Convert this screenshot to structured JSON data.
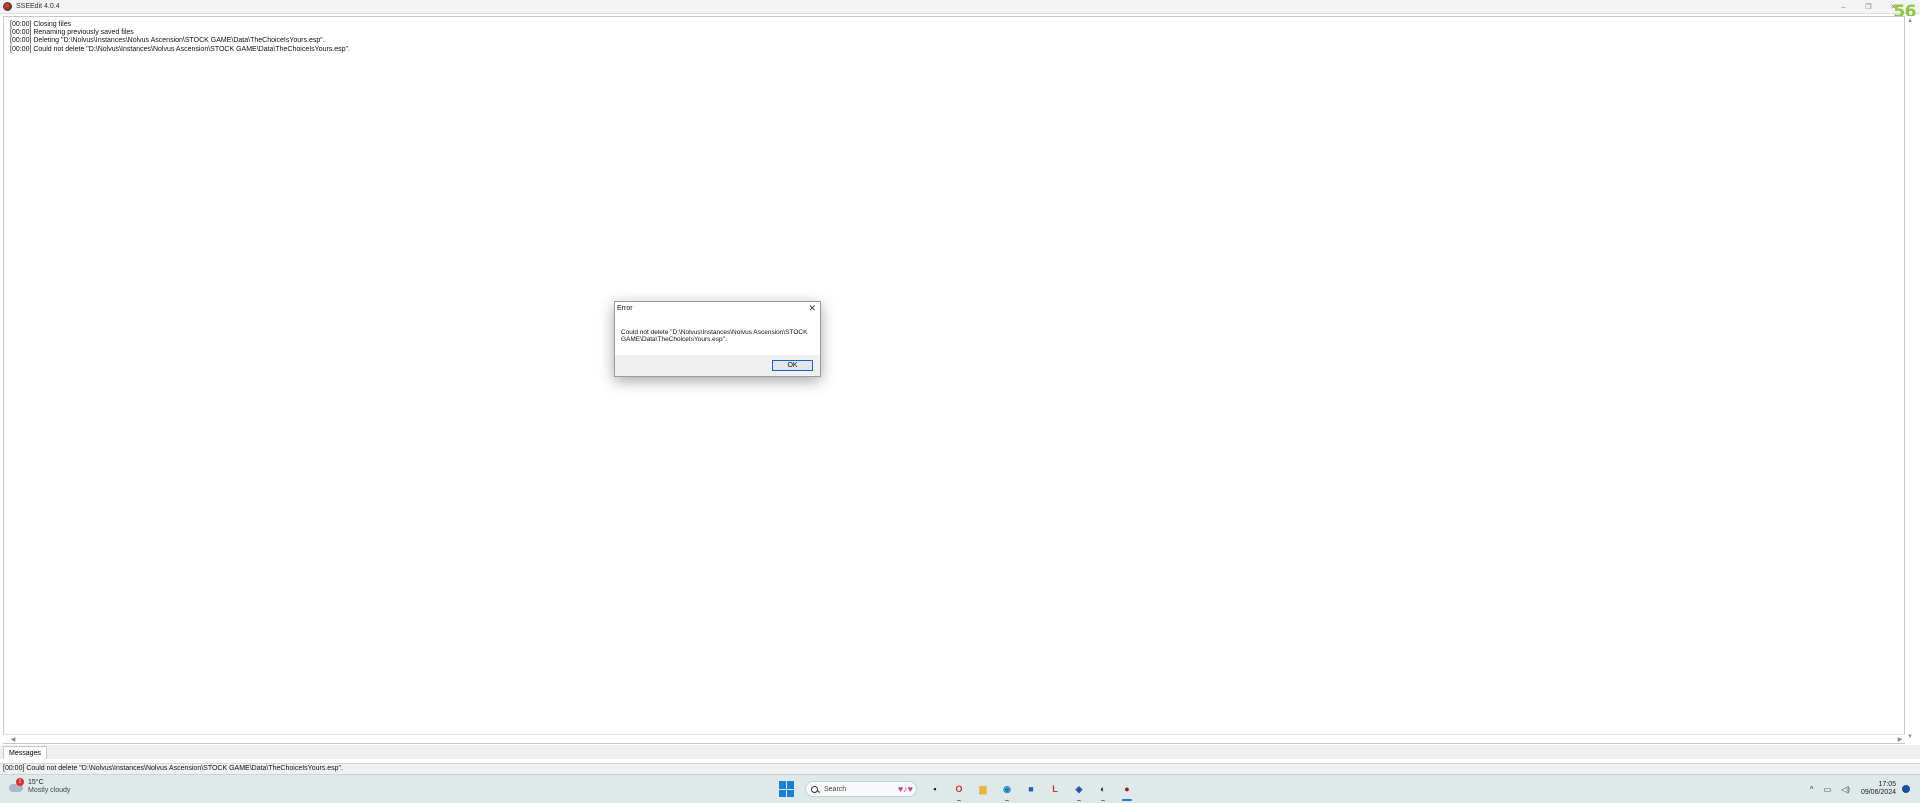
{
  "window": {
    "title": "SSEEdit 4.0.4",
    "controls": {
      "minimize": "–",
      "maximize": "❐",
      "close": "✕"
    },
    "fps_overlay": "56"
  },
  "log": {
    "lines": [
      "[00:00] Closing files",
      "[00:00] Renaming previously saved files",
      "[00:00] Deleting \"D:\\Nolvus\\Instances\\Nolvus Ascension\\STOCK GAME\\Data\\TheChoiceIsYours.esp\".",
      "[00:00] Could not delete \"D:\\Nolvus\\Instances\\Nolvus Ascension\\STOCK GAME\\Data\\TheChoiceIsYours.esp\"."
    ]
  },
  "scrollbars": {
    "up_arrow": "▲",
    "down_arrow": "▼",
    "left_arrow": "◀",
    "right_arrow": "▶"
  },
  "tabs": [
    {
      "label": "Messages"
    }
  ],
  "status_bar": {
    "text": "[00:00] Could not delete \"D:\\Nolvus\\Instances\\Nolvus Ascension\\STOCK GAME\\Data\\TheChoiceIsYours.esp\"."
  },
  "dialog": {
    "title": "Error",
    "close_glyph": "✕",
    "message": "Could not delete \"D:\\Nolvus\\Instances\\Nolvus Ascension\\STOCK GAME\\Data\\TheChoiceIsYours.esp\".",
    "ok_label": "OK"
  },
  "taskbar": {
    "weather": {
      "temp": "15°C",
      "desc": "Mostly cloudy",
      "badge": "1",
      "icon": "cloud-icon"
    },
    "search": {
      "label": "Search",
      "deco": "♥♪♥"
    },
    "apps": [
      {
        "name": "terminal-icon",
        "glyph": "▪",
        "color": "#222222"
      },
      {
        "name": "opera-icon",
        "glyph": "O",
        "color": "#d0312d"
      },
      {
        "name": "file-explorer-icon",
        "glyph": "▆",
        "color": "#e8b53a"
      },
      {
        "name": "edge-icon",
        "glyph": "◉",
        "color": "#1a7fbf"
      },
      {
        "name": "store-icon",
        "glyph": "■",
        "color": "#2063b0"
      },
      {
        "name": "l-app-icon",
        "glyph": "L",
        "color": "#d0312d"
      },
      {
        "name": "controller-icon",
        "glyph": "◈",
        "color": "#1b4f9c"
      },
      {
        "name": "steam-icon",
        "glyph": "◐",
        "color": "#1b2838"
      },
      {
        "name": "sseedit-icon",
        "glyph": "●",
        "color": "#a11d18"
      }
    ],
    "tray": {
      "chevron": "^",
      "network_glyph": "▭",
      "volume_glyph": "◁)",
      "time": "17:05",
      "date": "09/06/2024"
    }
  },
  "colors": {
    "fps": "#8cc63f",
    "ok_border": "#0a64d6",
    "accent": "#1b7fd4"
  }
}
